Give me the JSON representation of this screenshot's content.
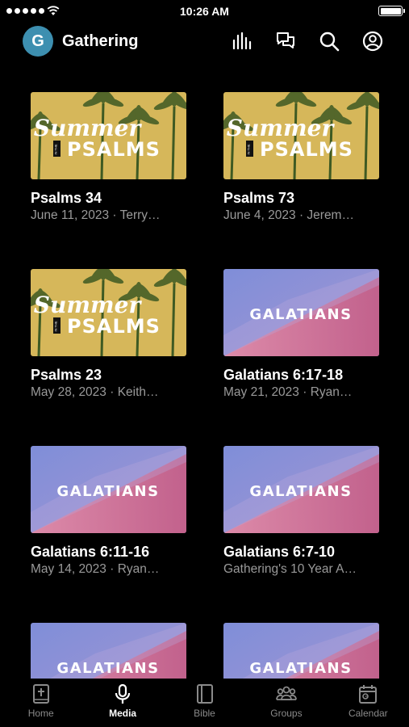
{
  "status": {
    "time": "10:26 AM"
  },
  "header": {
    "logo_letter": "G",
    "title": "Gathering"
  },
  "series": {
    "summer": {
      "script": "Summer",
      "small": "IN THE",
      "main": "PSALMS"
    },
    "galatians": {
      "main": "GALATIANS"
    }
  },
  "cards": [
    {
      "title": "Psalms 34",
      "meta": "June 11, 2023 · Terry…",
      "artwork": "summer"
    },
    {
      "title": "Psalms 73",
      "meta": "June 4, 2023 · Jerem…",
      "artwork": "summer"
    },
    {
      "title": "Psalms 23",
      "meta": "May 28, 2023 · Keith…",
      "artwork": "summer"
    },
    {
      "title": "Galatians 6:17-18",
      "meta": "May 21, 2023 · Ryan…",
      "artwork": "galatians"
    },
    {
      "title": "Galatians 6:11-16",
      "meta": "May 14, 2023 · Ryan…",
      "artwork": "galatians"
    },
    {
      "title": "Galatians 6:7-10",
      "meta": "Gathering's 10 Year A…",
      "artwork": "galatians"
    },
    {
      "title": "",
      "meta": "",
      "artwork": "galatians"
    },
    {
      "title": "",
      "meta": "",
      "artwork": "galatians"
    }
  ],
  "tabs": [
    {
      "label": "Home",
      "icon": "home-bible-icon"
    },
    {
      "label": "Media",
      "icon": "microphone-icon",
      "active": true
    },
    {
      "label": "Bible",
      "icon": "book-icon"
    },
    {
      "label": "Groups",
      "icon": "groups-icon"
    },
    {
      "label": "Calendar",
      "icon": "calendar-icon"
    }
  ]
}
